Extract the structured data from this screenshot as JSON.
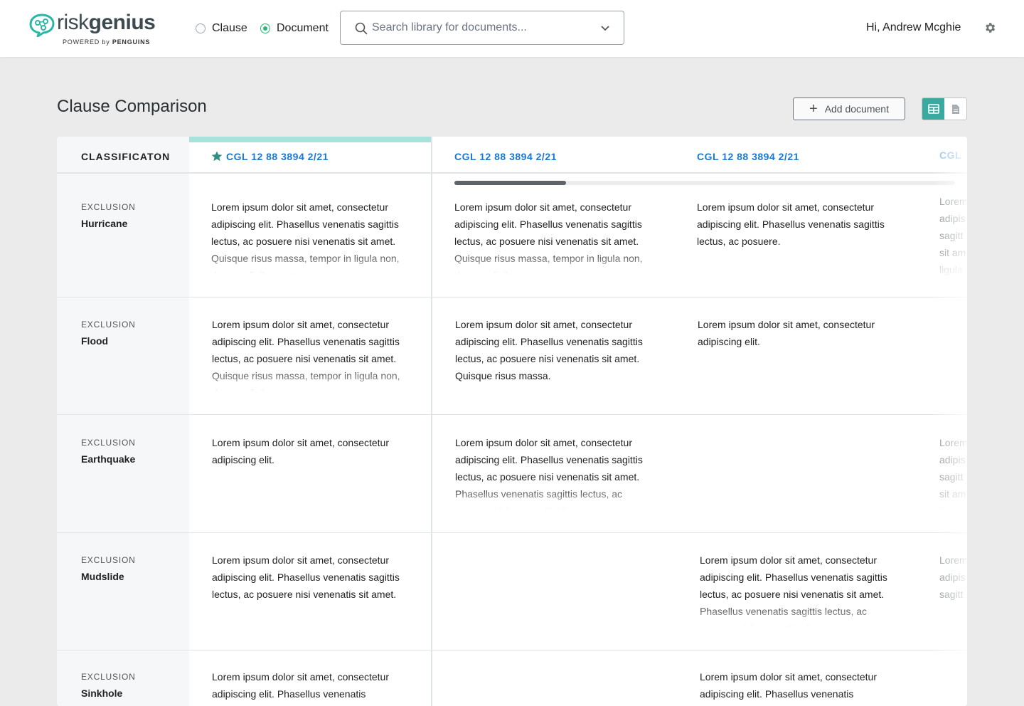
{
  "header": {
    "logo": {
      "name_light": "risk",
      "name_bold": "genius",
      "tagline_prefix": "POWERED by",
      "tagline_brand": "PENGUINS"
    },
    "mode": {
      "options": [
        "Clause",
        "Document"
      ],
      "selected": "Document"
    },
    "search": {
      "placeholder": "Search library for documents...",
      "value": ""
    },
    "greeting": "Hi, Andrew Mcghie",
    "settings_icon": "gear-icon"
  },
  "page": {
    "title": "Clause Comparison",
    "add_document_label": "Add document",
    "view_toggle": {
      "options": [
        "table-view-icon",
        "document-view-icon"
      ],
      "active": "table-view-icon"
    }
  },
  "colors": {
    "accent": "#3aa99f",
    "link": "#1a77d2",
    "radio_active": "#2bb673",
    "header_accent": "#a8e2dc"
  },
  "table": {
    "classification_header": "CLASSIFICATON",
    "documents": [
      {
        "label": "CGL 12 88 3894 2/21",
        "starred": true
      },
      {
        "label": "CGL 12 88 3894 2/21",
        "starred": false
      },
      {
        "label": "CGL 12 88 3894 2/21",
        "starred": false
      },
      {
        "label": "CGL",
        "starred": false
      }
    ],
    "scroll_position": 0.22,
    "rows": [
      {
        "type": "EXCLUSION",
        "name": "Hurricane",
        "cells": [
          "Lorem ipsum dolor sit amet, consectetur adipiscing elit. Phasellus venenatis sagittis lectus, ac posuere nisi venenatis sit amet. Quisque risus massa, tempor in ligula non, rhoncus finibus nunc.",
          "Lorem ipsum dolor sit amet, consectetur adipiscing elit. Phasellus venenatis sagittis lectus, ac posuere nisi venenatis sit amet. Quisque risus massa, tempor in ligula non, rhoncus finibus nunc.",
          "Lorem ipsum dolor sit amet, consectetur adipiscing elit. Phasellus venenatis sagittis lectus, ac posuere.",
          "Lorem adipis sagitt sit am ligula"
        ]
      },
      {
        "type": "EXCLUSION",
        "name": "Flood",
        "cells": [
          "Lorem ipsum dolor sit amet, consectetur adipiscing elit. Phasellus venenatis sagittis lectus, ac posuere nisi venenatis sit amet. Quisque risus massa, tempor in ligula non, rhoncus finibus nunc.",
          "Lorem ipsum dolor sit amet, consectetur adipiscing elit. Phasellus venenatis sagittis lectus, ac posuere nisi venenatis sit amet. Quisque risus massa.",
          "Lorem ipsum dolor sit amet, consectetur adipiscing elit.",
          ""
        ]
      },
      {
        "type": "EXCLUSION",
        "name": "Earthquake",
        "cells": [
          "Lorem ipsum dolor sit amet, consectetur adipiscing elit.",
          "Lorem ipsum dolor sit amet, consectetur adipiscing elit. Phasellus venenatis sagittis lectus, ac posuere nisi venenatis sit amet.  Phasellus venenatis sagittis lectus, ac posuere nisi venenatis sit.",
          "",
          "Lorem adipis sagitt sit am ligula"
        ]
      },
      {
        "type": "EXCLUSION",
        "name": "Mudslide",
        "cells": [
          "Lorem ipsum dolor sit amet, consectetur adipiscing elit. Phasellus venenatis sagittis lectus, ac posuere nisi venenatis sit amet.",
          "",
          "Lorem ipsum dolor sit amet, consectetur adipiscing elit. Phasellus venenatis sagittis lectus, ac posuere nisi venenatis sit amet.  Phasellus venenatis sagittis lectus, ac posuere nisi venenatis sit.",
          "Lorem adipis sagitt"
        ]
      },
      {
        "type": "EXCLUSION",
        "name": "Sinkhole",
        "cells": [
          "Lorem ipsum dolor sit amet, consectetur adipiscing elit. Phasellus venenatis",
          "",
          "Lorem ipsum dolor sit amet, consectetur adipiscing elit. Phasellus venenatis",
          ""
        ]
      }
    ]
  }
}
